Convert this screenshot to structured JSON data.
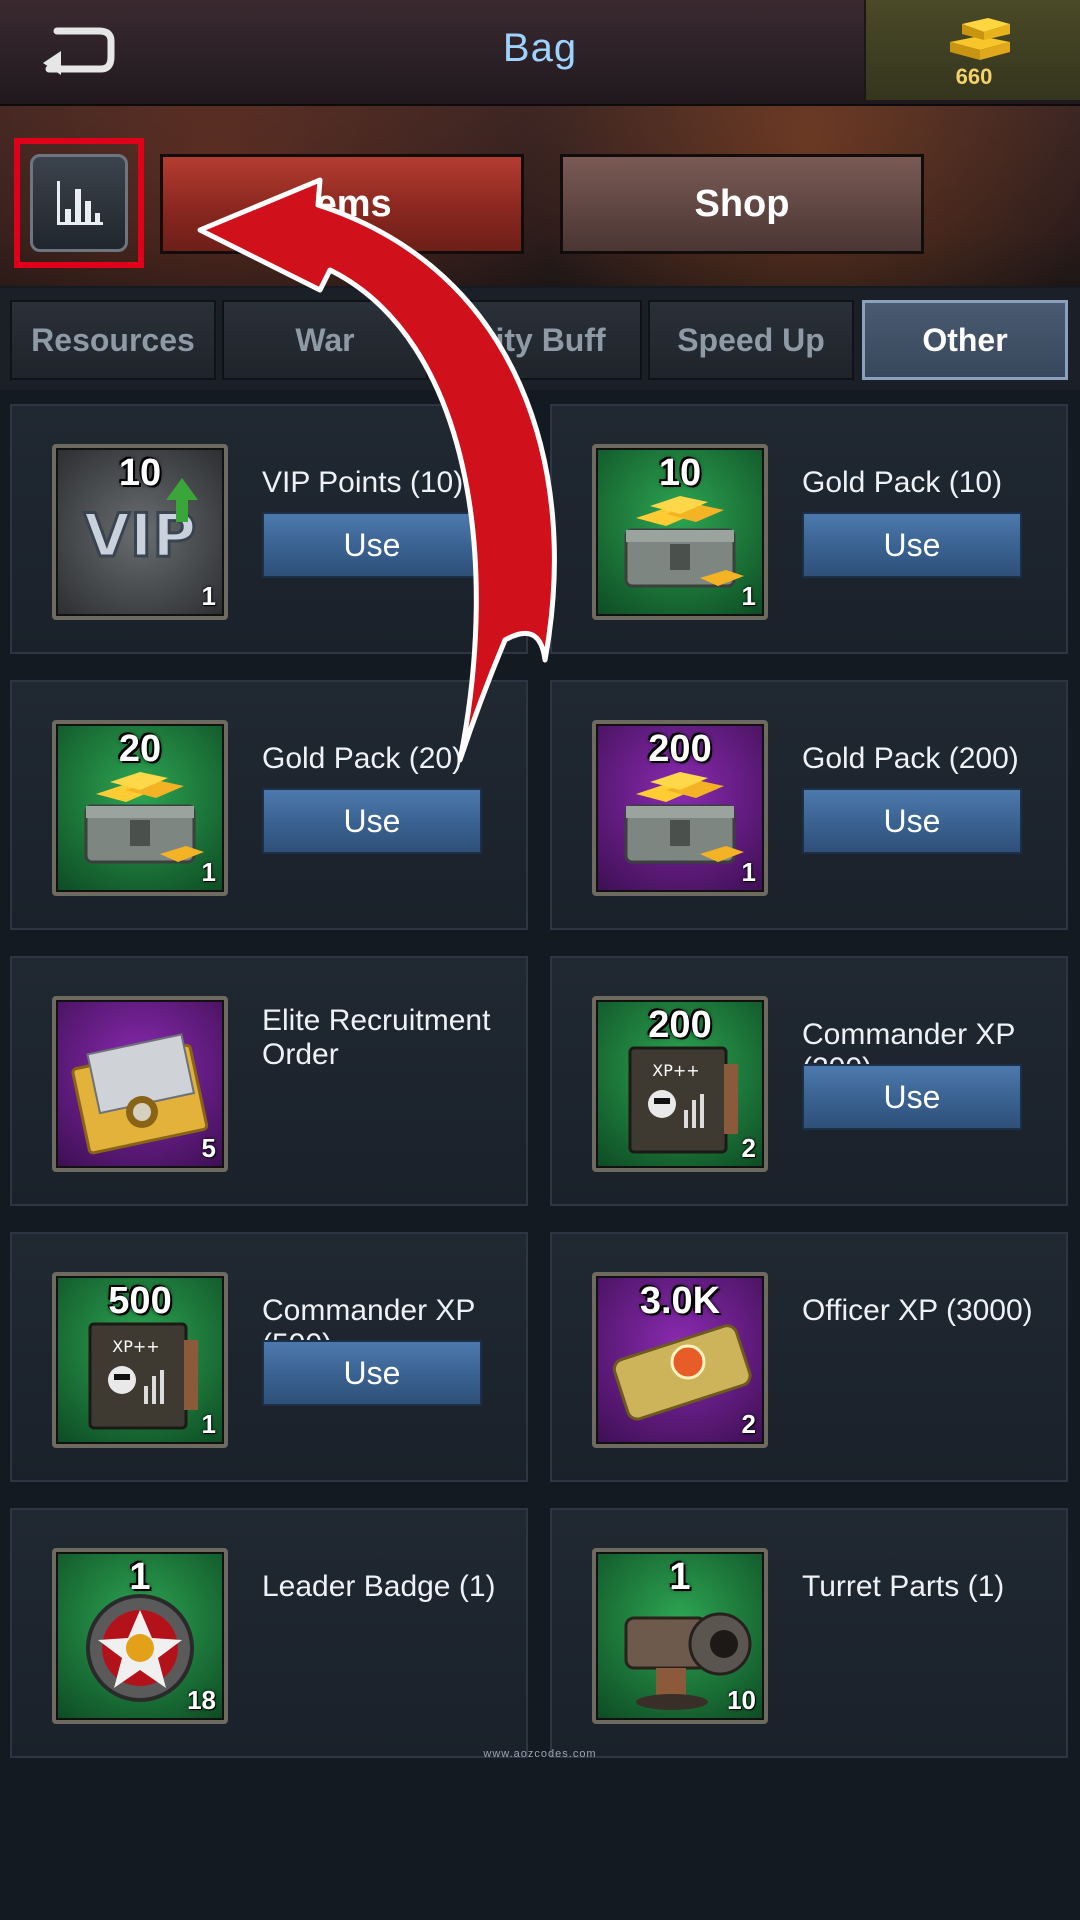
{
  "header": {
    "title": "Bag",
    "gold_amount": "660"
  },
  "main_tabs": {
    "items": "Items",
    "shop": "Shop"
  },
  "sub_tabs": [
    "Resources",
    "War",
    "City Buff",
    "Speed Up",
    "Other"
  ],
  "active_sub_tab": "Other",
  "items": [
    {
      "name": "VIP Points (10)",
      "badge": "10",
      "count": "1",
      "bg": "grey",
      "art": "vip-badge-icon",
      "use": "Use"
    },
    {
      "name": "Gold Pack (10)",
      "badge": "10",
      "count": "1",
      "bg": "green",
      "art": "gold-chest-icon",
      "use": "Use"
    },
    {
      "name": "Gold Pack (20)",
      "badge": "20",
      "count": "1",
      "bg": "green",
      "art": "gold-chest-icon",
      "use": "Use"
    },
    {
      "name": "Gold Pack (200)",
      "badge": "200",
      "count": "1",
      "bg": "purple",
      "art": "gold-chest-icon",
      "use": "Use"
    },
    {
      "name": "Elite Recruitment Order",
      "badge": "",
      "count": "5",
      "bg": "purple",
      "art": "envelope-icon",
      "use": ""
    },
    {
      "name": "Commander XP (200)",
      "badge": "200",
      "count": "2",
      "bg": "green",
      "art": "xp-book-icon",
      "use": "Use"
    },
    {
      "name": "Commander XP (500)",
      "badge": "500",
      "count": "1",
      "bg": "green",
      "art": "xp-book-icon",
      "use": "Use"
    },
    {
      "name": "Officer XP (3000)",
      "badge": "3.0K",
      "count": "2",
      "bg": "purple",
      "art": "officer-xp-icon",
      "use": ""
    },
    {
      "name": "Leader Badge (1)",
      "badge": "1",
      "count": "18",
      "bg": "green",
      "art": "medal-icon",
      "use": ""
    },
    {
      "name": "Turret Parts (1)",
      "badge": "1",
      "count": "10",
      "bg": "green",
      "art": "turret-icon",
      "use": ""
    }
  ],
  "watermark": "www.aozcodes.com",
  "colors": {
    "accent_red": "#e1001a",
    "use_button": "#4c79ad",
    "title_blue": "#9fd3ff",
    "gold": "#f2d36a"
  }
}
